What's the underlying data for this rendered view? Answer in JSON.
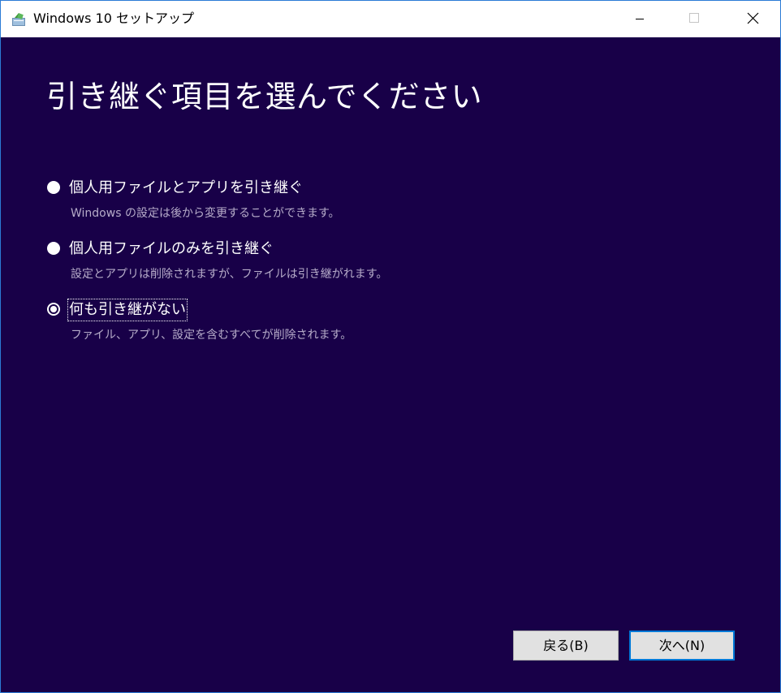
{
  "window": {
    "title": "Windows 10 セットアップ",
    "icon": "setup-app-icon",
    "controls": {
      "minimize_icon": "minimize-icon",
      "maximize_icon": "maximize-icon",
      "close_icon": "close-icon"
    }
  },
  "page": {
    "title": "引き継ぐ項目を選んでください"
  },
  "options": [
    {
      "label": "個人用ファイルとアプリを引き継ぐ",
      "description": "Windows の設定は後から変更することができます。",
      "selected": false
    },
    {
      "label": "個人用ファイルのみを引き継ぐ",
      "description": "設定とアプリは削除されますが、ファイルは引き継がれます。",
      "selected": false
    },
    {
      "label": "何も引き継がない",
      "description": "ファイル、アプリ、設定を含むすべてが削除されます。",
      "selected": true
    }
  ],
  "buttons": {
    "back_label": "戻る(B)",
    "next_label": "次へ(N)"
  },
  "colors": {
    "background": "#180048",
    "description_text": "#b6acc9",
    "accent": "#0078d7",
    "button_face": "#e1e1e1"
  }
}
